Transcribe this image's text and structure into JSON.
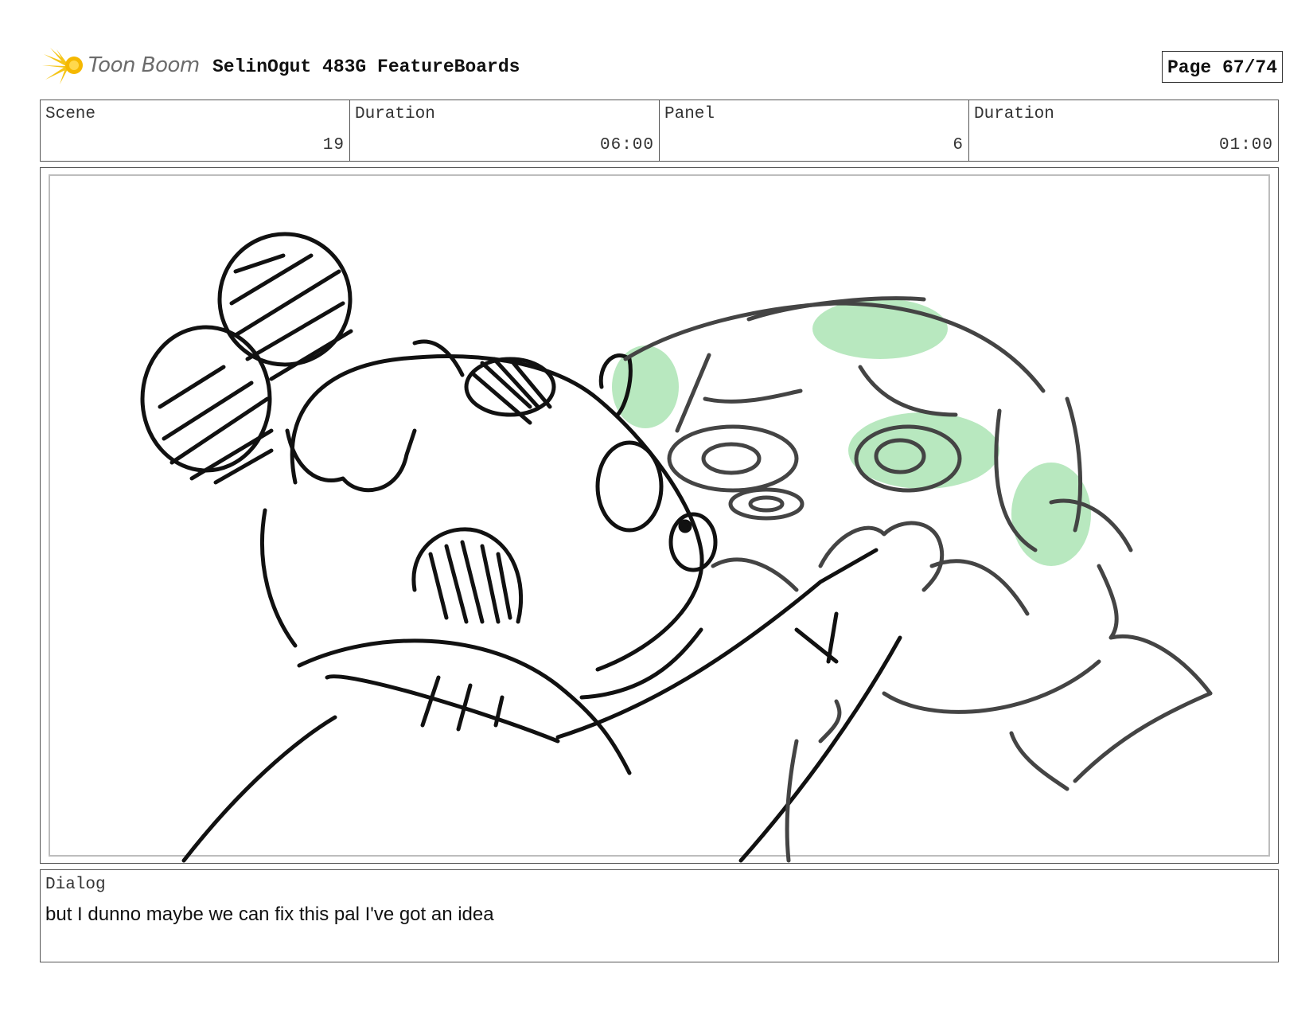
{
  "header": {
    "logo_text": "Toon Boom",
    "project_title": "SelinOgut 483G FeatureBoards",
    "page": "Page 67/74"
  },
  "info": {
    "scene_label": "Scene",
    "scene_value": "19",
    "scene_duration_label": "Duration",
    "scene_duration_value": "06:00",
    "panel_label": "Panel",
    "panel_value": "6",
    "panel_duration_label": "Duration",
    "panel_duration_value": "01:00"
  },
  "panel_image": {
    "description_icon": "storyboard-sketch",
    "highlight_color": "#b8e8bf"
  },
  "dialog": {
    "label": "Dialog",
    "text": "but I dunno maybe we can fix this pal I've got an idea"
  }
}
